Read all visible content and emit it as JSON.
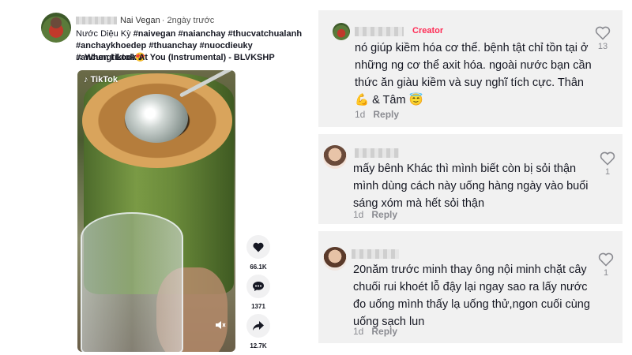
{
  "post": {
    "username": "Nai Vegan",
    "time": "· 2ngày trước",
    "caption_start": "Nước Diệu Kỳ ",
    "hashtags": [
      "#naivegan",
      "#naianchay",
      "#thucvatchualanh",
      "#anchaykhoedep",
      "#thuanchay",
      "#nuocdieuky",
      "#ancungtiktok"
    ],
    "caption_emoji": "😍",
    "music": "When I Look At You (Instrumental) - BLVKSHP",
    "video_logo": "TikTok",
    "actions": [
      {
        "icon": "heart-icon",
        "count": "66.1K"
      },
      {
        "icon": "comment-icon",
        "count": "1371"
      },
      {
        "icon": "share-icon",
        "count": "12.7K"
      }
    ]
  },
  "comments": [
    {
      "creator_badge": "Creator",
      "text": "nó giúp kiềm hóa cơ thể. bệnh tật chỉ tồn tại ở những ng cơ thể axit hóa. ngoài nước bạn cần thức ăn giàu kiềm và suy nghĩ tích cực. Thân💪 & Tâm 😇",
      "age": "1d",
      "reply": "Reply",
      "likes": "13"
    },
    {
      "text": "mấy bênh Khác thì mình biết còn bị sỏi thận mình dùng cách này uống hàng ngày vào buổi sáng xóm mà hết sỏi thận",
      "age": "1d",
      "reply": "Reply",
      "likes": "1"
    },
    {
      "text": "20năm trước minh thay ông nội minh chặt cây chuối rui khoét lỗ đậy lại ngay sao ra lấy nước đo uống mình thấy lạ uống thử,ngon cuối cùng uống sạch lun",
      "age": "1d",
      "reply": "Reply",
      "likes": "1"
    }
  ],
  "colors": {
    "creator": "#fe2c55",
    "card_bg": "#f1f1f1",
    "muted": "#8a8b91"
  }
}
